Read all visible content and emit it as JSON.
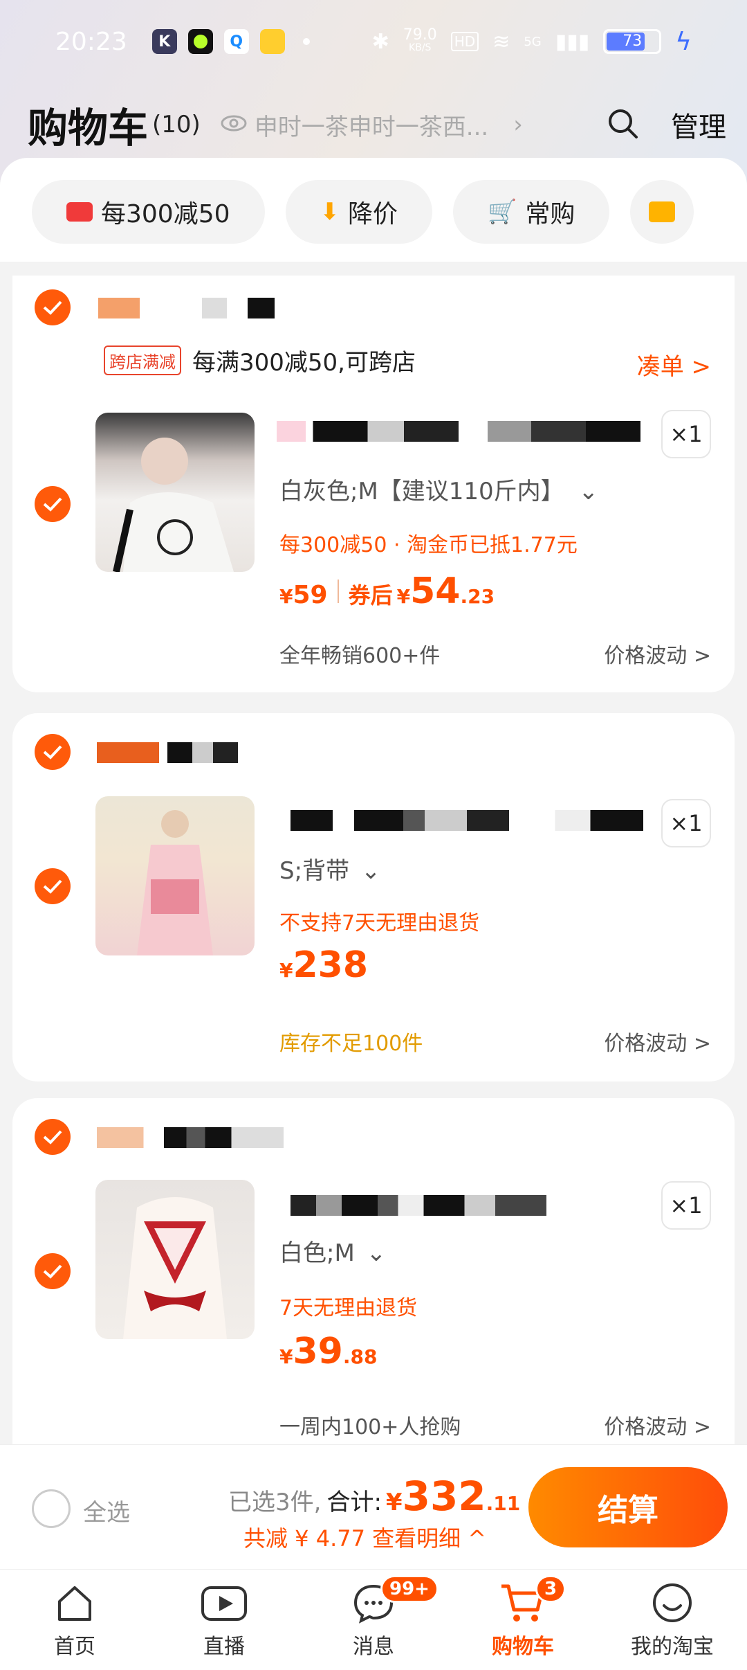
{
  "colors": {
    "accent": "#ff5000",
    "check": "#ff5a0a"
  },
  "status_bar": {
    "time": "20:23",
    "net_speed": "79.0",
    "net_unit": "KB/S",
    "hd": "HD",
    "signal": "5G",
    "battery": "73"
  },
  "header": {
    "title": "购物车",
    "count": "(10)",
    "shop_hint": "申时一茶申时一茶西...",
    "manage": "管理"
  },
  "filters": [
    {
      "label": "每300减50",
      "icon": "red-gift-icon"
    },
    {
      "label": "降价",
      "icon": "price-drop-icon"
    },
    {
      "label": "常购",
      "icon": "cart-icon"
    },
    {
      "label": "",
      "icon": "folder-icon"
    }
  ],
  "promo": {
    "tag": "跨店满减",
    "text": "每满300减50,可跨店",
    "link": "凑单 >"
  },
  "items": [
    {
      "sku": "白灰色;M【建议110斤内】",
      "tagline": "每300减50 · 淘金币已抵1.77元",
      "price_sym": "¥",
      "price": "59",
      "coupon_label": "券后",
      "after_sym": "¥",
      "after_int": "54",
      "after_dec": ".23",
      "qty": "×1",
      "note": "全年畅销600+件",
      "trend": "价格波动 >"
    },
    {
      "sku": "S;背带",
      "tagline": "不支持7天无理由退货",
      "price_sym": "¥",
      "price": "238",
      "qty": "×1",
      "note": "库存不足100件",
      "trend": "价格波动 >"
    },
    {
      "sku": "白色;M",
      "tagline": "7天无理由退货",
      "price_sym": "¥",
      "price": "39",
      "price_dec": ".88",
      "qty": "×1",
      "note": "一周内100+人抢购",
      "trend": "价格波动 >"
    }
  ],
  "checkout": {
    "select_all": "全选",
    "selected": "已选3件,",
    "total_label": "合计:",
    "total_sym": "¥",
    "total_int": "332",
    "total_dec": ".11",
    "discount": "共减 ¥ 4.77  查看明细 ^",
    "pay": "结算"
  },
  "tabs": [
    {
      "label": "首页",
      "icon": "home-icon"
    },
    {
      "label": "直播",
      "icon": "live-play-icon"
    },
    {
      "label": "消息",
      "icon": "message-icon",
      "badge": "99+"
    },
    {
      "label": "购物车",
      "icon": "cart-icon",
      "badge": "3",
      "active": true
    },
    {
      "label": "我的淘宝",
      "icon": "smile-face-icon"
    }
  ]
}
